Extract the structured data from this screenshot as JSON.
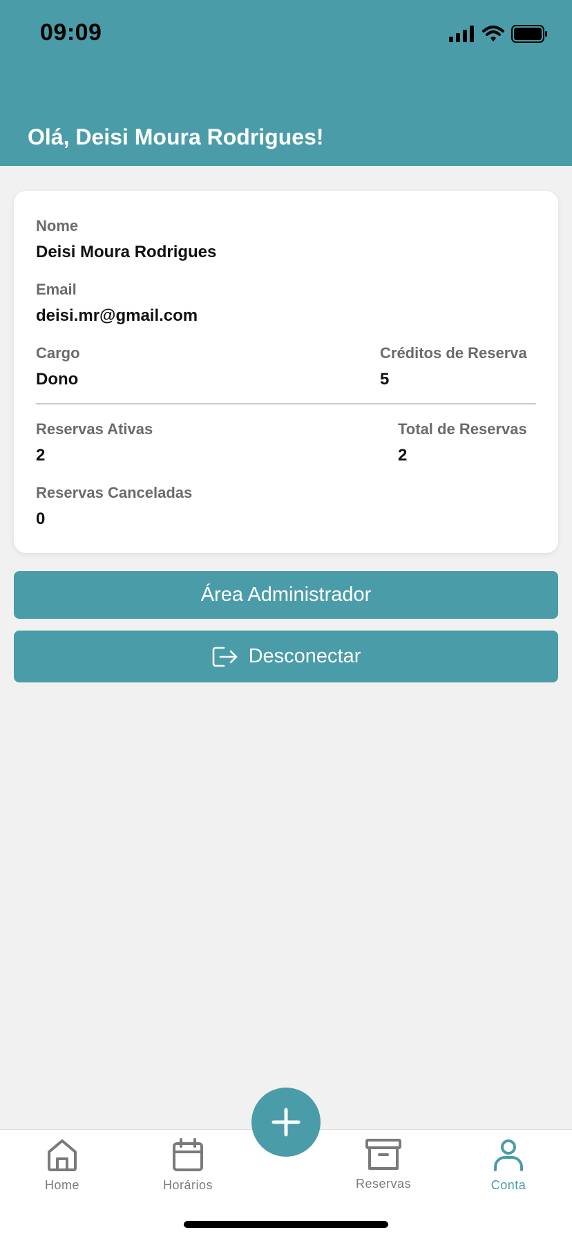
{
  "status_bar": {
    "time": "09:09"
  },
  "header": {
    "greeting": "Olá, Deisi Moura Rodrigues!"
  },
  "profile": {
    "name_label": "Nome",
    "name_value": "Deisi Moura Rodrigues",
    "email_label": "Email",
    "email_value": "deisi.mr@gmail.com",
    "role_label": "Cargo",
    "role_value": "Dono",
    "credits_label": "Créditos de Reserva",
    "credits_value": "5",
    "active_label": "Reservas Ativas",
    "active_value": "2",
    "total_label": "Total de Reservas",
    "total_value": "2",
    "cancelled_label": "Reservas Canceladas",
    "cancelled_value": "0"
  },
  "actions": {
    "admin_label": "Área Administrador",
    "logout_label": "Desconectar"
  },
  "tabbar": {
    "items": [
      {
        "label": "Home",
        "icon": "home-icon"
      },
      {
        "label": "Horários",
        "icon": "calendar-icon"
      },
      {
        "label": "Reservas",
        "icon": "archive-icon"
      },
      {
        "label": "Conta",
        "icon": "user-icon",
        "active": true
      }
    ],
    "fab_icon": "plus-icon"
  },
  "colors": {
    "accent": "#4a9ca8",
    "background": "#f1f1f2",
    "card": "#ffffff"
  }
}
